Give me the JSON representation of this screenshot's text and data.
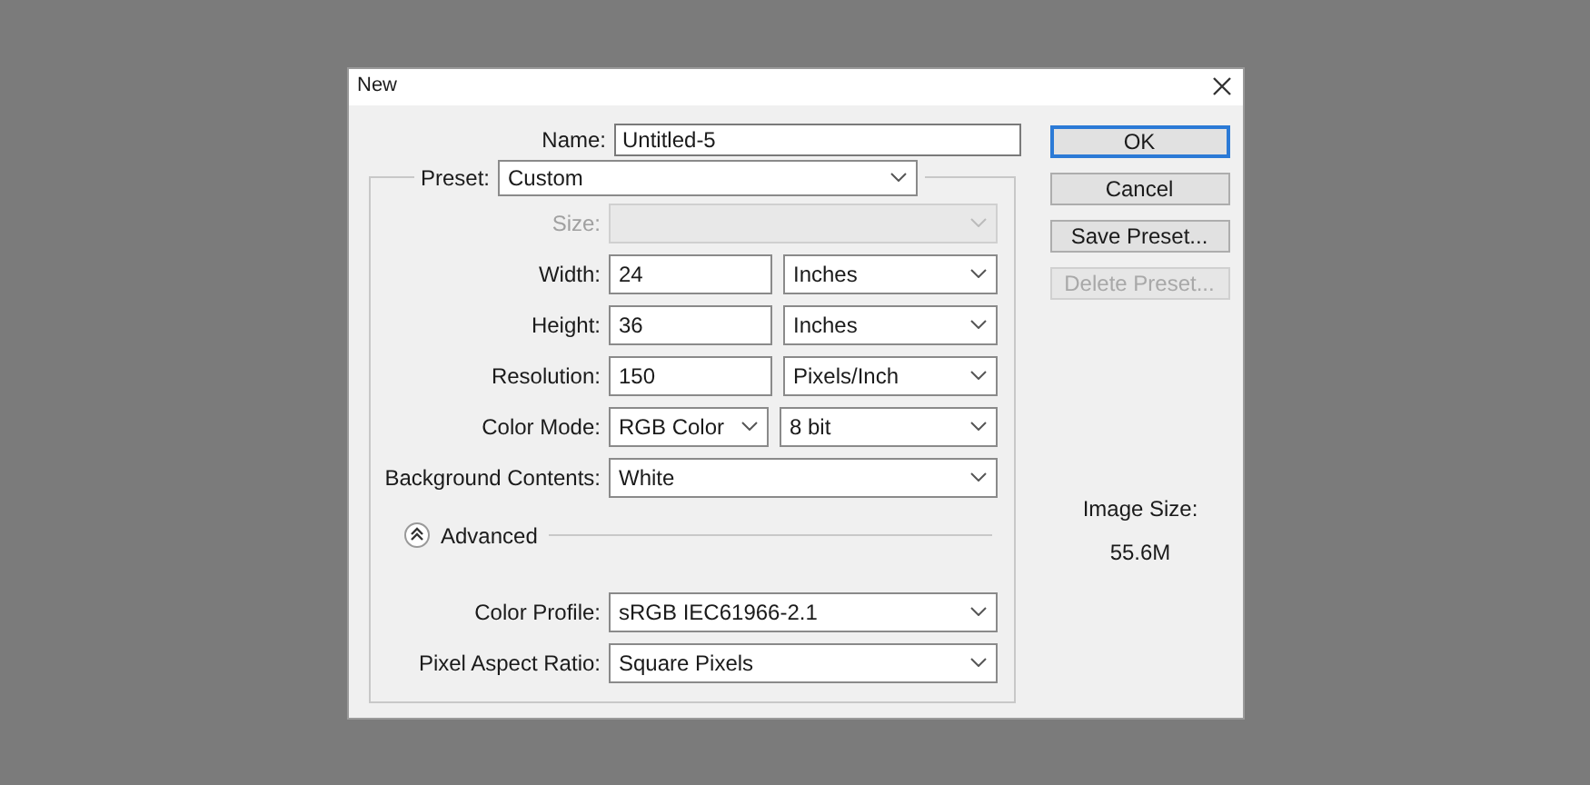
{
  "window": {
    "title": "New"
  },
  "name": {
    "label": "Name:",
    "value": "Untitled-5"
  },
  "preset": {
    "label": "Preset:",
    "value": "Custom"
  },
  "rows": [
    {
      "kind": "select",
      "label": "Size:",
      "value": "",
      "disabled": true
    },
    {
      "kind": "number_unit",
      "label": "Width:",
      "value": "24",
      "unit": "Inches",
      "disabled": false
    },
    {
      "kind": "number_unit",
      "label": "Height:",
      "value": "36",
      "unit": "Inches",
      "disabled": false
    },
    {
      "kind": "number_unit",
      "label": "Resolution:",
      "value": "150",
      "unit": "Pixels/Inch",
      "disabled": false
    },
    {
      "kind": "two_selects",
      "label": "Color Mode:",
      "value": "RGB Color",
      "unit": "8 bit",
      "disabled": false
    },
    {
      "kind": "select",
      "label": "Background Contents:",
      "value": "White",
      "disabled": false
    }
  ],
  "advanced": {
    "label": "Advanced",
    "expanded": true
  },
  "advanced_rows": [
    {
      "kind": "select",
      "label": "Color Profile:",
      "value": "sRGB IEC61966-2.1",
      "disabled": false
    },
    {
      "kind": "select",
      "label": "Pixel Aspect Ratio:",
      "value": "Square Pixels",
      "disabled": false
    }
  ],
  "buttons": [
    {
      "label": "OK",
      "default": true,
      "disabled": false
    },
    {
      "label": "Cancel",
      "default": false,
      "disabled": false
    },
    {
      "label": "Save Preset...",
      "default": false,
      "disabled": false
    },
    {
      "label": "Delete Preset...",
      "default": false,
      "disabled": true
    }
  ],
  "image_size": {
    "label": "Image Size:",
    "value": "55.6M"
  }
}
